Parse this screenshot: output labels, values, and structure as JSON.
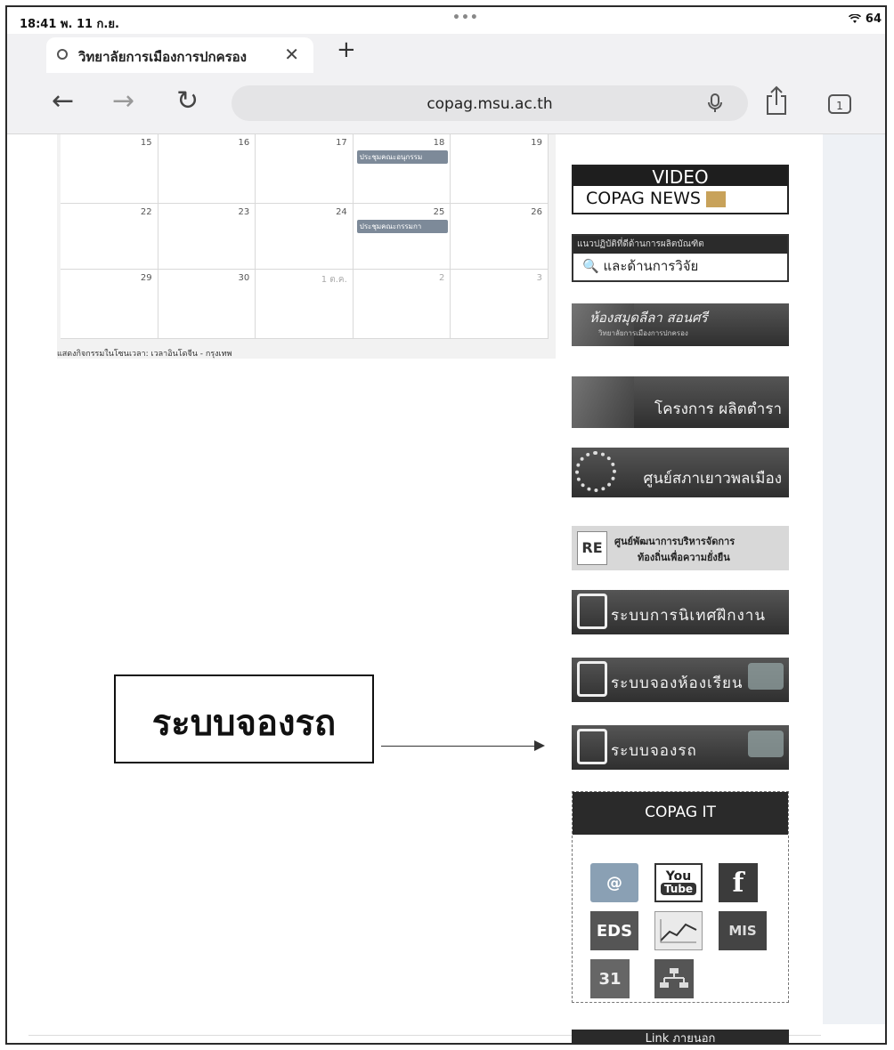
{
  "status_bar": {
    "time": "18:41  พ. 11 ก.ย.",
    "dots": "•••",
    "battery": "64"
  },
  "tab": {
    "title": "วิทยาลัยการเมืองการปกครอง",
    "close": "✕",
    "new_tab": "+"
  },
  "toolbar": {
    "back": "←",
    "forward": "→",
    "reload": "↻",
    "url": "copag.msu.ac.th",
    "tabs_count": "1"
  },
  "calendar": {
    "weeks": [
      [
        {
          "day": "15",
          "event": ""
        },
        {
          "day": "16",
          "event": ""
        },
        {
          "day": "17",
          "event": ""
        },
        {
          "day": "18",
          "event": "ประชุมคณะอนุกรรม"
        },
        {
          "day": "19",
          "event": ""
        }
      ],
      [
        {
          "day": "22",
          "event": ""
        },
        {
          "day": "23",
          "event": ""
        },
        {
          "day": "24",
          "event": ""
        },
        {
          "day": "25",
          "event": "ประชุมคณะกรรมกา"
        },
        {
          "day": "26",
          "event": ""
        }
      ],
      [
        {
          "day": "29",
          "event": ""
        },
        {
          "day": "30",
          "event": ""
        },
        {
          "day": "1 ต.ค.",
          "event": ""
        },
        {
          "day": "2",
          "event": ""
        },
        {
          "day": "3",
          "event": ""
        }
      ]
    ],
    "timezone_note": "แสดงกิจกรรมในโซนเวลา: เวลาอินโดจีน - กรุงเทพ"
  },
  "sidebar": {
    "video_top": "VIDEO",
    "video_bottom": "COPAG NEWS",
    "sop_top": "แนวปฏิบัติที่ดีด้านการผลิตบัณฑิต",
    "sop_bottom": "และด้านการวิจัย",
    "library_title": "ห้องสมุดลีลา สอนศรี",
    "library_sub": "วิทยาลัยการเมืองการปกครอง",
    "textbook": "โครงการ ผลิตตำรา",
    "youth": "ศูนย์สภาเยาวพลเมือง",
    "local_line1": "ศูนย์พัฒนาการบริหารจัดการ",
    "local_line2": "ท้องถิ่นเพื่อความยั่งยืน",
    "local_logo": "RE",
    "internship": "ระบบการนิเทศฝึกงาน",
    "room_booking": "ระบบจองห้องเรียน",
    "car_booking": "ระบบจองรถ",
    "it_title": "COPAG IT",
    "it_icons": [
      "@",
      "You",
      "Tube",
      "f",
      "EDS",
      "MIS",
      "31"
    ],
    "next_banner": "Link ภายนอก"
  },
  "annotation": {
    "label": "ระบบจองรถ"
  }
}
